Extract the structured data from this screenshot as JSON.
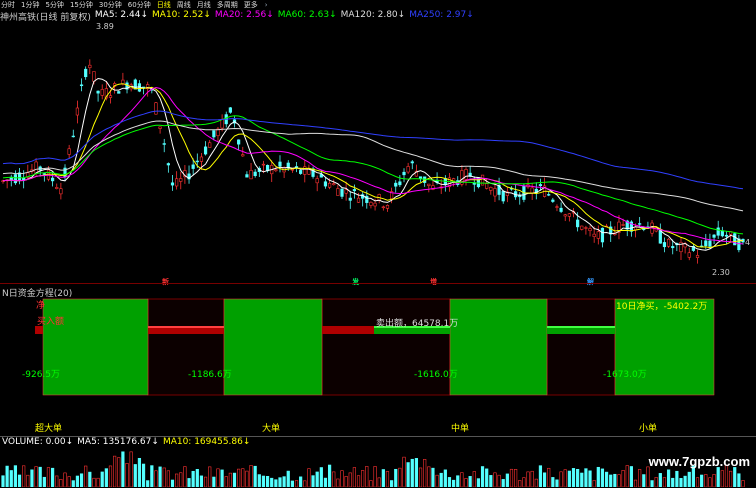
{
  "toolbar": {
    "items": [
      {
        "label": "分时",
        "active": false
      },
      {
        "label": "1分钟",
        "active": false
      },
      {
        "label": "5分钟",
        "active": false
      },
      {
        "label": "15分钟",
        "active": false
      },
      {
        "label": "30分钟",
        "active": false
      },
      {
        "label": "60分钟",
        "active": false
      },
      {
        "label": "日线",
        "active": true
      },
      {
        "label": "周线",
        "active": false
      },
      {
        "label": "月线",
        "active": false
      },
      {
        "label": "多周期",
        "active": false
      },
      {
        "label": "更多",
        "active": false
      }
    ],
    "icon": "chevron-right-icon"
  },
  "legend": {
    "title": "神州高铁(日线 前复权)",
    "items": [
      {
        "label": "MA5: 2.44",
        "arrow": "↓",
        "color": "#ffffff"
      },
      {
        "label": "MA10: 2.52",
        "arrow": "↓",
        "color": "#ffff00"
      },
      {
        "label": "MA20: 2.56",
        "arrow": "↓",
        "color": "#ff00ff"
      },
      {
        "label": "MA60: 2.63",
        "arrow": "↓",
        "color": "#00ff00"
      },
      {
        "label": "MA120: 2.80",
        "arrow": "↓",
        "color": "#dddddd"
      },
      {
        "label": "MA250: 2.97",
        "arrow": "↓",
        "color": "#3040ff"
      }
    ]
  },
  "price_labels": {
    "high": "3.89",
    "low": "2.30",
    "right_edge": "4"
  },
  "markers": [
    {
      "label": "新",
      "color": "#ff3333"
    },
    {
      "label": "发",
      "color": "#00ff66"
    },
    {
      "label": "增",
      "color": "#ff3333"
    },
    {
      "label": "解",
      "color": "#3399ff"
    }
  ],
  "fund": {
    "title": "N日资金方程(20)",
    "corner_label": "净",
    "buy_text": "买入额",
    "sell_text": "卖出额，64578.1万",
    "net_text": "10日净买，-5402.2万",
    "groups": [
      {
        "name": "超大单",
        "value": "-926.5万"
      },
      {
        "name": "大单",
        "value": "-1186.6万"
      },
      {
        "name": "中单",
        "value": "-1616.0万"
      },
      {
        "name": "小单",
        "value": "-1673.0万"
      }
    ]
  },
  "volume": {
    "items": [
      {
        "label": "VOLUME: 0.00",
        "arrow": "↓",
        "color": "#ffffff"
      },
      {
        "label": "MA5: 135176.67",
        "arrow": "↓",
        "color": "#ffffff"
      },
      {
        "label": "MA10: 169455.86",
        "arrow": "↓",
        "color": "#ffff00"
      }
    ]
  },
  "watermark": "www.7gpzb.com",
  "colors": {
    "up": "#ff3232",
    "down": "#54ffff",
    "ma5": "#ffffff",
    "ma10": "#ffff00",
    "ma20": "#ff00ff",
    "ma60": "#00ff00",
    "ma120": "#dddddd",
    "ma250": "#3040ff",
    "fund_green": "#00a000",
    "fund_red": "#b00000"
  }
}
